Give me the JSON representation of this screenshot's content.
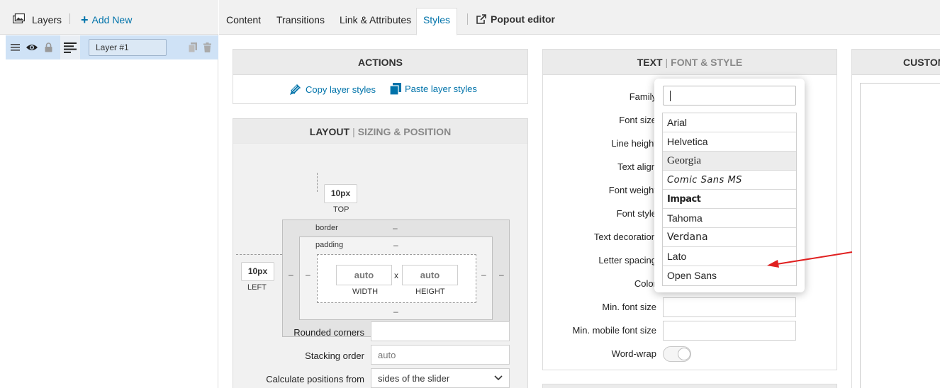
{
  "layers_panel": {
    "title": "Layers",
    "add_new": "Add New",
    "layers": [
      {
        "name": "Layer #1",
        "selected": true
      }
    ]
  },
  "tabs": {
    "items": [
      "Content",
      "Transitions",
      "Link & Attributes",
      "Styles"
    ],
    "active": "Styles",
    "popout": "Popout editor"
  },
  "actions": {
    "title": "ACTIONS",
    "copy": "Copy layer styles",
    "paste": "Paste layer styles"
  },
  "layout": {
    "title": "LAYOUT",
    "subtitle": "SIZING & POSITION",
    "top_value": "10px",
    "top_caption": "TOP",
    "left_value": "10px",
    "left_caption": "LEFT",
    "border_label": "border",
    "padding_label": "padding",
    "dash": "–",
    "width_value": "auto",
    "height_value": "auto",
    "times": "x",
    "width_caption": "WIDTH",
    "height_caption": "HEIGHT",
    "rounded_corners_label": "Rounded corners",
    "rounded_corners_value": "",
    "stacking_order_label": "Stacking order",
    "stacking_order_value": "auto",
    "calc_positions_label": "Calculate positions from",
    "calc_positions_value": "sides of the slider"
  },
  "text": {
    "title": "TEXT",
    "subtitle": "FONT & STYLE",
    "labels": {
      "family": "Family",
      "font_size": "Font size",
      "line_height": "Line height",
      "text_align": "Text align",
      "font_weight": "Font weight",
      "font_style": "Font style",
      "text_decoration": "Text decoration",
      "letter_spacing": "Letter spacing",
      "color": "Color",
      "min_font_size": "Min. font size",
      "min_mobile_font_size": "Min. mobile font size",
      "word_wrap": "Word-wrap"
    },
    "word_wrap_on": false
  },
  "font_dropdown": {
    "search_value": "",
    "options": [
      "Arial",
      "Helvetica",
      "Georgia",
      "Comic Sans MS",
      "Impact",
      "Tahoma",
      "Verdana",
      "Lato",
      "Open Sans"
    ],
    "highlighted": "Georgia"
  },
  "custom": {
    "title": "CUSTOM"
  },
  "colors": {
    "accent": "#0073aa",
    "selected_layer_bg": "#cfe2f6",
    "annotation_arrow": "#e02020"
  }
}
